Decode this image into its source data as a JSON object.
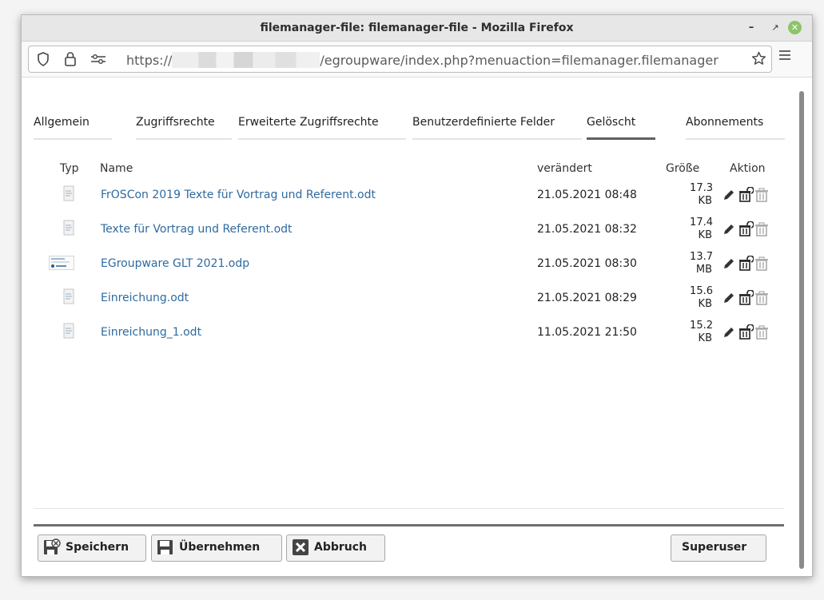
{
  "window": {
    "title": "filemanager-file: filemanager-file - Mozilla Firefox",
    "min_glyph": "–",
    "max_glyph": "↗",
    "close_glyph": "✕"
  },
  "urlbar": {
    "url_prefix": "https://",
    "url_rest": "/egroupware/index.php?menuaction=filemanager.filemanager"
  },
  "tabs": [
    {
      "label": "Allgemein",
      "active": false
    },
    {
      "label": "Zugriffsrechte",
      "active": false
    },
    {
      "label": "Erweiterte Zugriffsrechte",
      "active": false
    },
    {
      "label": "Benutzerdefinierte Felder",
      "active": false
    },
    {
      "label": "Gelöscht",
      "active": true
    },
    {
      "label": "Abonnements",
      "active": false
    }
  ],
  "table": {
    "headers": {
      "type": "Typ",
      "name": "Name",
      "modified": "verändert",
      "size": "Größe",
      "action": "Aktion"
    },
    "rows": [
      {
        "name": "FrOSCon 2019 Texte für Vortrag und Referent.odt",
        "modified": "21.05.2021 08:48",
        "size_value": "17.3",
        "size_unit": "KB",
        "type_icon": "odt-file-icon"
      },
      {
        "name": "Texte für Vortrag und Referent.odt",
        "modified": "21.05.2021 08:32",
        "size_value": "17.4",
        "size_unit": "KB",
        "type_icon": "odt-file-icon"
      },
      {
        "name": "EGroupware GLT 2021.odp",
        "modified": "21.05.2021 08:30",
        "size_value": "13.7",
        "size_unit": "MB",
        "type_icon": "presentation-thumbnail-icon"
      },
      {
        "name": "Einreichung.odt",
        "modified": "21.05.2021 08:29",
        "size_value": "15.6",
        "size_unit": "KB",
        "type_icon": "odt-file-icon"
      },
      {
        "name": "Einreichung_1.odt",
        "modified": "11.05.2021 21:50",
        "size_value": "15.2",
        "size_unit": "KB",
        "type_icon": "odt-file-icon"
      }
    ]
  },
  "buttons": {
    "save": "Speichern",
    "apply": "Übernehmen",
    "cancel": "Abbruch",
    "superuser": "Superuser"
  },
  "colors": {
    "link": "#2f6aa0",
    "tab_active_underline": "#606060",
    "window_close": "#8dc46a"
  }
}
